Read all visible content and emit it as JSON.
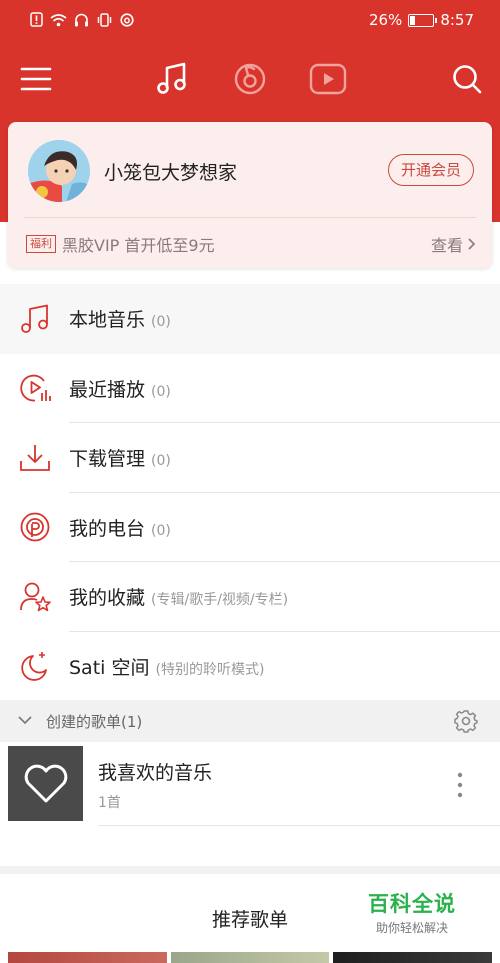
{
  "status_bar": {
    "battery": "26%",
    "battery_level": 0.26,
    "time": "8:57"
  },
  "topnav": {
    "icons": [
      "menu-icon",
      "music-note-icon",
      "netease-icon",
      "video-play-icon",
      "search-icon"
    ],
    "accent": "#d9342b"
  },
  "profile": {
    "username": "小笼包大梦想家",
    "vip_button": "开通会员",
    "promo_tag": "福利",
    "promo_text": "黑胶VIP 首开低至9元",
    "promo_link": "查看"
  },
  "menu": [
    {
      "label": "本地音乐",
      "count": "(0)",
      "icon": "music-note-icon"
    },
    {
      "label": "最近播放",
      "count": "(0)",
      "icon": "recent-play-icon"
    },
    {
      "label": "下载管理",
      "count": "(0)",
      "icon": "download-icon"
    },
    {
      "label": "我的电台",
      "count": "(0)",
      "icon": "radio-icon"
    },
    {
      "label": "我的收藏",
      "count": "(专辑/歌手/视频/专栏)",
      "icon": "favorite-icon"
    },
    {
      "label": "Sati 空间",
      "count": "(特别的聆听模式)",
      "icon": "moon-icon"
    }
  ],
  "playlists": {
    "section_title": "创建的歌单(1)",
    "items": [
      {
        "name": "我喜欢的音乐",
        "count": "1首",
        "icon": "heart-icon"
      }
    ]
  },
  "recommend": {
    "title": "推荐歌单"
  },
  "watermark": {
    "main": "百科全说",
    "sub": "助你轻松解决"
  }
}
